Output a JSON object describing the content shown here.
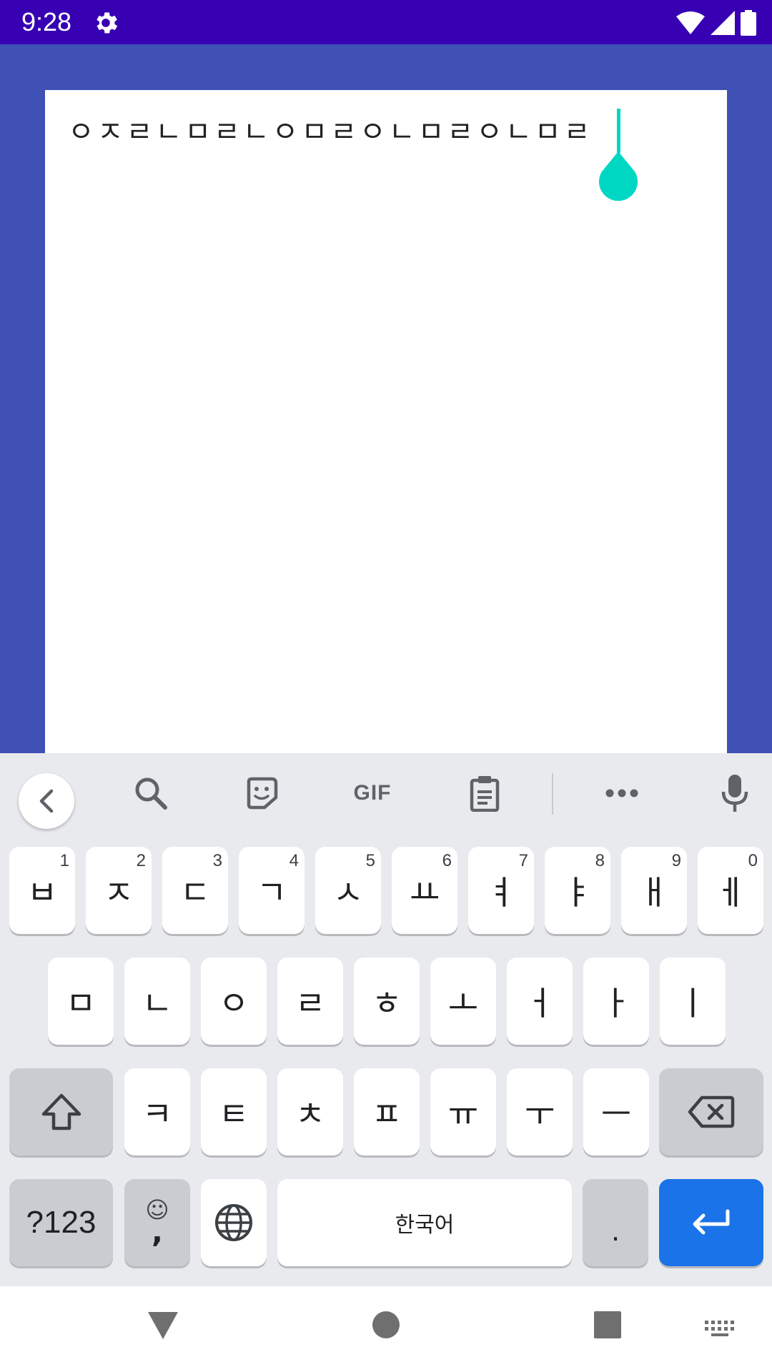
{
  "status_bar": {
    "time": "9:28"
  },
  "editor": {
    "text": "ㅇㅈㄹㄴㅁㄹㄴㅇㅁㄹㅇㄴㅁㄹㅇㄴㅁㄹ"
  },
  "keyboard": {
    "toolbar": {
      "gif_label": "GIF"
    },
    "row1": [
      {
        "label": "ㅂ",
        "hint": "1"
      },
      {
        "label": "ㅈ",
        "hint": "2"
      },
      {
        "label": "ㄷ",
        "hint": "3"
      },
      {
        "label": "ㄱ",
        "hint": "4"
      },
      {
        "label": "ㅅ",
        "hint": "5"
      },
      {
        "label": "ㅛ",
        "hint": "6"
      },
      {
        "label": "ㅕ",
        "hint": "7"
      },
      {
        "label": "ㅑ",
        "hint": "8"
      },
      {
        "label": "ㅐ",
        "hint": "9"
      },
      {
        "label": "ㅔ",
        "hint": "0"
      }
    ],
    "row2": [
      "ㅁ",
      "ㄴ",
      "ㅇ",
      "ㄹ",
      "ㅎ",
      "ㅗ",
      "ㅓ",
      "ㅏ",
      "ㅣ"
    ],
    "row3": [
      "ㅋ",
      "ㅌ",
      "ㅊ",
      "ㅍ",
      "ㅠ",
      "ㅜ",
      "ㅡ"
    ],
    "symbols_label": "?123",
    "emoji_glyph": "☺",
    "comma_label": ",",
    "space_label": "한국어",
    "period_label": ".",
    "accent_color": "#1a73e8"
  }
}
